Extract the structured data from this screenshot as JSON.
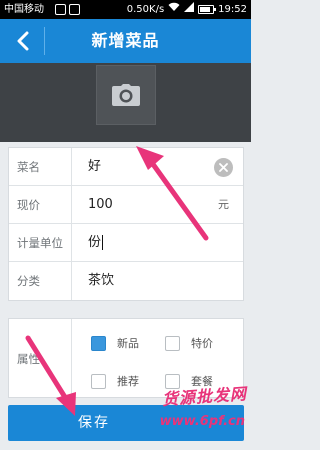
{
  "status_bar": {
    "carrier": "中国移动",
    "net_speed": "0.50K/s",
    "time": "19:52",
    "battery_level": 0.6
  },
  "nav": {
    "title": "新增菜品"
  },
  "form": {
    "fields": [
      {
        "label": "菜名",
        "value": "好"
      },
      {
        "label": "现价",
        "value": "100",
        "unit": "元"
      },
      {
        "label": "计量单位",
        "value": "份"
      },
      {
        "label": "分类",
        "value": "茶饮"
      }
    ]
  },
  "attributes": {
    "label": "属性",
    "options": [
      {
        "label": "新品",
        "checked": true
      },
      {
        "label": "特价",
        "checked": false
      },
      {
        "label": "推荐",
        "checked": false
      },
      {
        "label": "套餐",
        "checked": false
      }
    ]
  },
  "save_button": {
    "label": "保存"
  },
  "watermark": {
    "text": "货源批发网",
    "url": "www.6pf.cn"
  },
  "colors": {
    "primary": "#1a87d6",
    "annotation": "#e8347a",
    "checkbox_checked": "#3a97dd"
  }
}
